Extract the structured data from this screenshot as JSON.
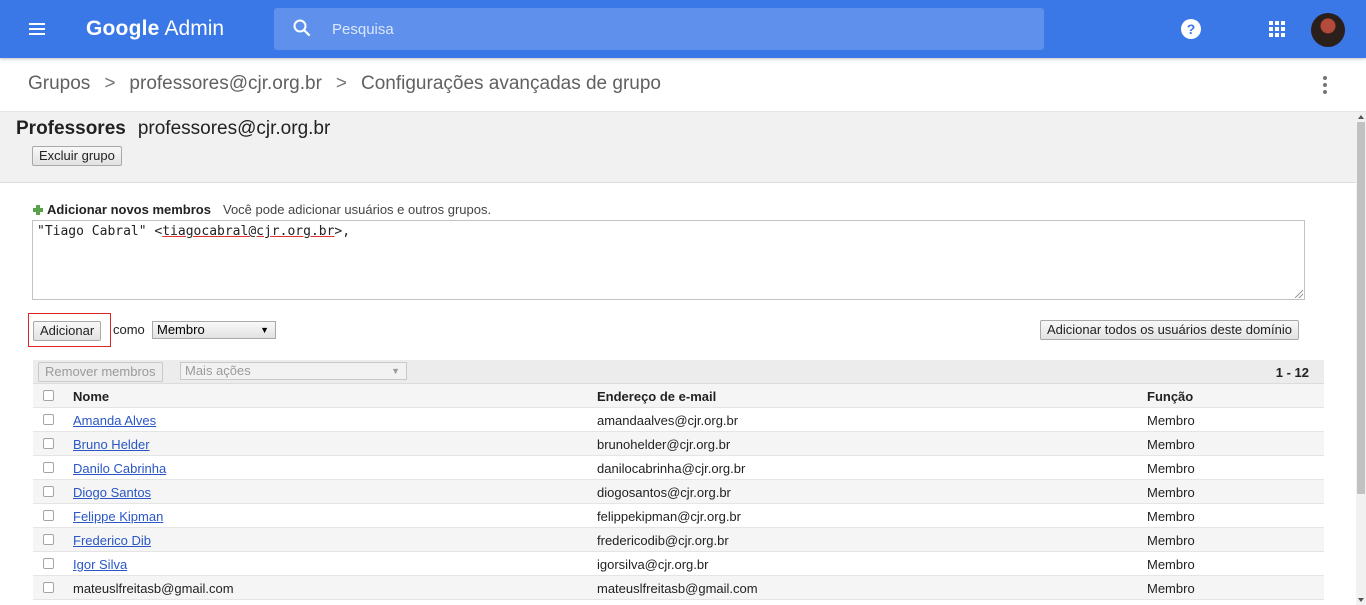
{
  "app": {
    "brand_google": "Google",
    "brand_admin": "Admin",
    "colors": {
      "topbar": "#3b78e7",
      "search_bg": "#5f91ec",
      "link": "#2a56c6",
      "highlight_border": "#e02424"
    }
  },
  "search": {
    "placeholder": "Pesquisa"
  },
  "icons": [
    "menu-icon",
    "search-icon",
    "help-icon",
    "apps-icon",
    "avatar",
    "more-vert-icon",
    "plus-icon"
  ],
  "breadcrumb": {
    "items": [
      "Grupos",
      "professores@cjr.org.br",
      "Configurações avançadas de grupo"
    ],
    "separator": ">"
  },
  "group": {
    "name": "Professores",
    "email": "professores@cjr.org.br",
    "delete_label": "Excluir grupo"
  },
  "add_members": {
    "title": "Adicionar novos membros",
    "hint": "Você pode adicionar usuários e outros grupos.",
    "text_prefix": "\"Tiago Cabral\" <",
    "text_email": "tiagocabral@cjr.org.br",
    "text_suffix": ">,",
    "add_label": "Adicionar",
    "as_label": "como",
    "role_value": "Membro",
    "add_all_label": "Adicionar todos os usuários deste domínio"
  },
  "table": {
    "remove_label": "Remover membros",
    "more_actions_label": "Mais ações",
    "pagination": "1 - 12",
    "columns": {
      "name": "Nome",
      "email": "Endereço de e-mail",
      "role": "Função"
    },
    "rows": [
      {
        "name": "Amanda Alves",
        "email": "amandaalves@cjr.org.br",
        "role": "Membro"
      },
      {
        "name": "Bruno Helder",
        "email": "brunohelder@cjr.org.br",
        "role": "Membro"
      },
      {
        "name": "Danilo Cabrinha",
        "email": "danilocabrinha@cjr.org.br",
        "role": "Membro"
      },
      {
        "name": "Diogo Santos",
        "email": "diogosantos@cjr.org.br",
        "role": "Membro"
      },
      {
        "name": "Felippe Kipman",
        "email": "felippekipman@cjr.org.br",
        "role": "Membro"
      },
      {
        "name": "Frederico Dib",
        "email": "fredericodib@cjr.org.br",
        "role": "Membro"
      },
      {
        "name": "Igor Silva",
        "email": "igorsilva@cjr.org.br",
        "role": "Membro"
      },
      {
        "name": "mateuslfreitasb@gmail.com",
        "email": "mateuslfreitasb@gmail.com",
        "role": "Membro"
      }
    ]
  }
}
